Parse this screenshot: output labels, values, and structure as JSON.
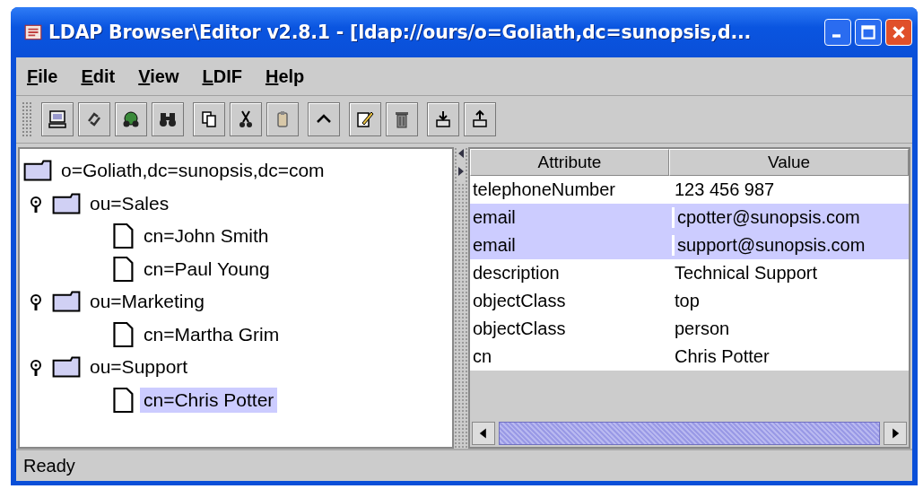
{
  "window": {
    "title": "LDAP Browser\\Editor v2.8.1 - [ldap://ours/o=Goliath,dc=sunopsis,d..."
  },
  "menu": [
    "File",
    "Edit",
    "View",
    "LDIF",
    "Help"
  ],
  "tree": {
    "label": "o=Goliath,dc=sunopsis,dc=com",
    "kind": "folder",
    "selected": false,
    "children": [
      {
        "label": "ou=Sales",
        "kind": "folder",
        "expanded": true,
        "selected": false,
        "children": [
          {
            "label": "cn=John Smith",
            "kind": "entry",
            "selected": false
          },
          {
            "label": "cn=Paul Young",
            "kind": "entry",
            "selected": false
          }
        ]
      },
      {
        "label": "ou=Marketing",
        "kind": "folder",
        "expanded": true,
        "selected": false,
        "children": [
          {
            "label": "cn=Martha Grim",
            "kind": "entry",
            "selected": false
          }
        ]
      },
      {
        "label": "ou=Support",
        "kind": "folder",
        "expanded": true,
        "selected": false,
        "children": [
          {
            "label": "cn=Chris Potter",
            "kind": "entry",
            "selected": true
          }
        ]
      }
    ]
  },
  "table": {
    "columns": [
      "Attribute",
      "Value"
    ],
    "rows": [
      {
        "cells": [
          "telephoneNumber",
          "123 456 987"
        ],
        "selected": false
      },
      {
        "cells": [
          "email",
          "cpotter@sunopsis.com"
        ],
        "selected": true
      },
      {
        "cells": [
          "email",
          "support@sunopsis.com"
        ],
        "selected": true
      },
      {
        "cells": [
          "description",
          "Technical Support"
        ],
        "selected": false
      },
      {
        "cells": [
          "objectClass",
          "top"
        ],
        "selected": false
      },
      {
        "cells": [
          "objectClass",
          "person"
        ],
        "selected": false
      },
      {
        "cells": [
          "cn",
          "Chris Potter"
        ],
        "selected": false
      }
    ]
  },
  "status_bar": "Ready"
}
